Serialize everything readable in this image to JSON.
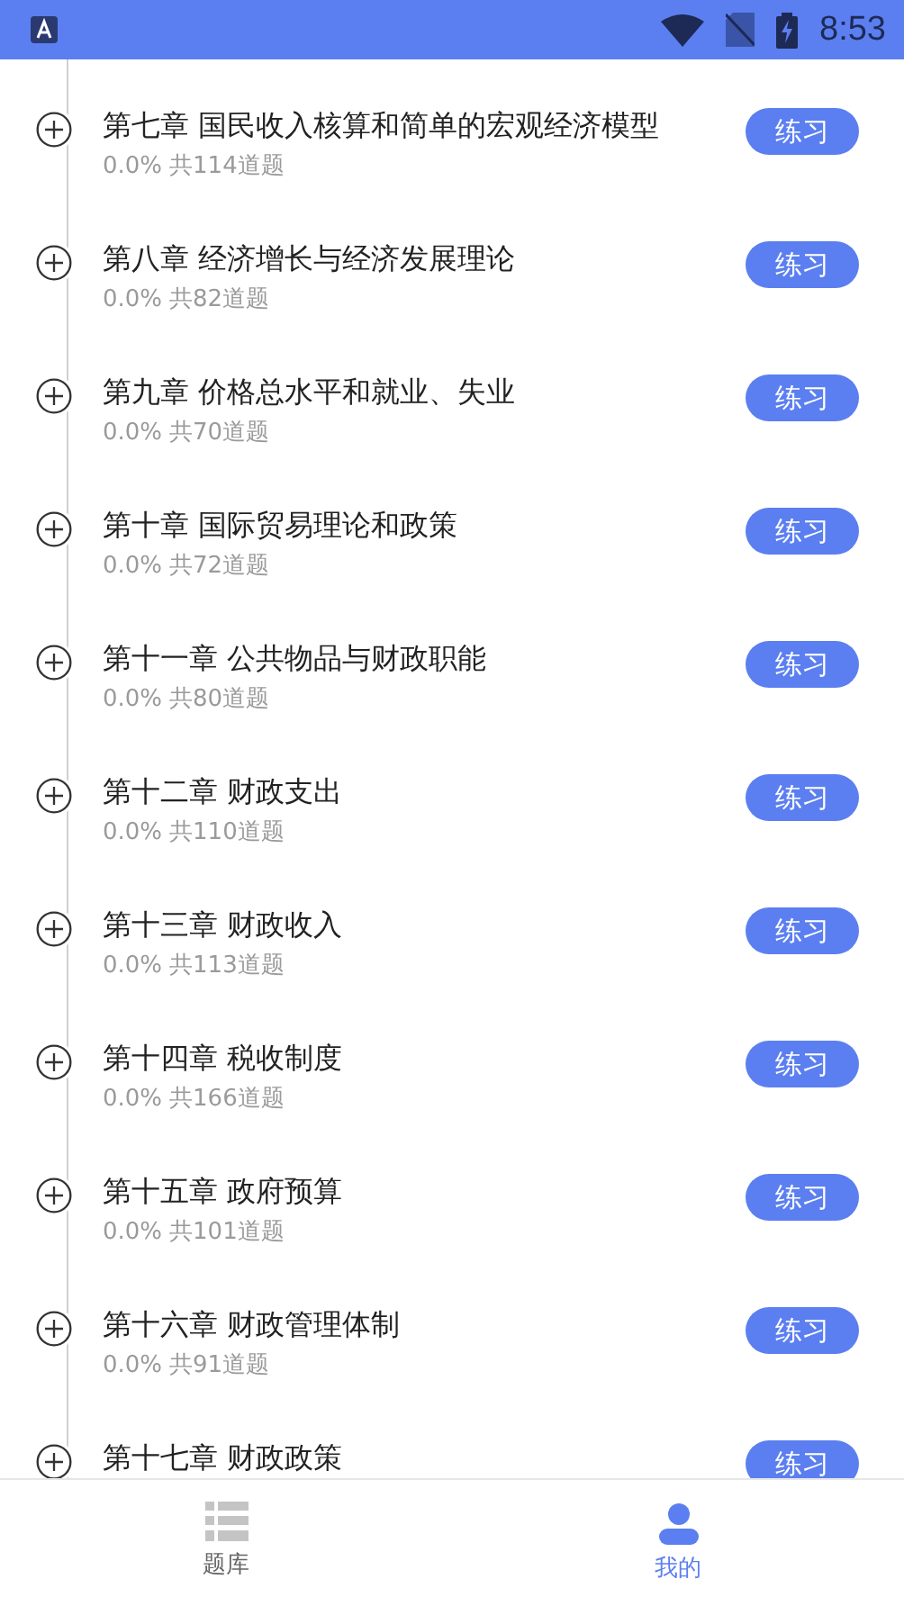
{
  "status_bar": {
    "time": "8:53"
  },
  "chapters": [
    {
      "title": "第七章 国民收入核算和简单的宏观经济模型",
      "progress": "0.0%",
      "count": "共114道题",
      "action": "练习"
    },
    {
      "title": "第八章 经济增长与经济发展理论",
      "progress": "0.0%",
      "count": "共82道题",
      "action": "练习"
    },
    {
      "title": "第九章 价格总水平和就业、失业",
      "progress": "0.0%",
      "count": "共70道题",
      "action": "练习"
    },
    {
      "title": "第十章 国际贸易理论和政策",
      "progress": "0.0%",
      "count": "共72道题",
      "action": "练习"
    },
    {
      "title": "第十一章 公共物品与财政职能",
      "progress": "0.0%",
      "count": "共80道题",
      "action": "练习"
    },
    {
      "title": "第十二章 财政支出",
      "progress": "0.0%",
      "count": "共110道题",
      "action": "练习"
    },
    {
      "title": "第十三章 财政收入",
      "progress": "0.0%",
      "count": "共113道题",
      "action": "练习"
    },
    {
      "title": "第十四章 税收制度",
      "progress": "0.0%",
      "count": "共166道题",
      "action": "练习"
    },
    {
      "title": "第十五章 政府预算",
      "progress": "0.0%",
      "count": "共101道题",
      "action": "练习"
    },
    {
      "title": "第十六章 财政管理体制",
      "progress": "0.0%",
      "count": "共91道题",
      "action": "练习"
    },
    {
      "title": "第十七章 财政政策",
      "action": "练习"
    }
  ],
  "bottom_nav": [
    {
      "label": "题库",
      "kind": "bank",
      "selected": false
    },
    {
      "label": "我的",
      "kind": "profile",
      "selected": true
    }
  ]
}
